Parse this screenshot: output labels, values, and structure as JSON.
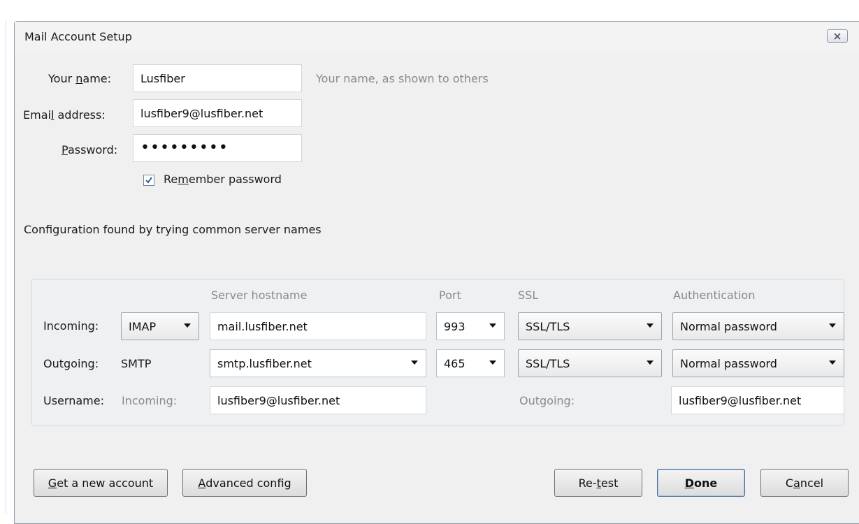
{
  "window": {
    "title": "Mail Account Setup"
  },
  "form": {
    "name_label_pre": "Your ",
    "name_label_u": "n",
    "name_label_post": "ame:",
    "name_value": "Lusfiber",
    "name_hint": "Your name, as shown to others",
    "email_label_pre": "Emai",
    "email_label_u": "l",
    "email_label_post": " address:",
    "email_value": "lusfiber9@lusfiber.net",
    "password_label_u": "P",
    "password_label_post": "assword:",
    "password_value": "•••••••••",
    "remember_checked": true,
    "remember_pre": "Re",
    "remember_u": "m",
    "remember_post": "ember password"
  },
  "status_text": "Configuration found by trying common server names",
  "servers": {
    "headers": {
      "hostname": "Server hostname",
      "port": "Port",
      "ssl": "SSL",
      "auth": "Authentication"
    },
    "incoming": {
      "label": "Incoming:",
      "protocol": "IMAP",
      "hostname": "mail.lusfiber.net",
      "port": "993",
      "ssl": "SSL/TLS",
      "auth": "Normal password"
    },
    "outgoing": {
      "label": "Outgoing:",
      "protocol": "SMTP",
      "hostname": "smtp.lusfiber.net",
      "port": "465",
      "ssl": "SSL/TLS",
      "auth": "Normal password"
    },
    "username": {
      "label": "Username:",
      "incoming_label": "Incoming:",
      "incoming_value": "lusfiber9@lusfiber.net",
      "outgoing_label": "Outgoing:",
      "outgoing_value": "lusfiber9@lusfiber.net"
    }
  },
  "buttons": {
    "new_account_u": "G",
    "new_account_post": "et a new account",
    "advanced_u": "A",
    "advanced_post": "dvanced config",
    "retest_pre": "Re-",
    "retest_u": "t",
    "retest_post": "est",
    "done_u": "D",
    "done_post": "one",
    "cancel_pre": "C",
    "cancel_u": "a",
    "cancel_post": "ncel"
  },
  "colors": {
    "window_bg": "#f0f0f0",
    "hint_text": "#8a8a8a",
    "checkbox_check": "#2a5ea8"
  },
  "icons": {
    "close": "close-icon",
    "dropdown": "dropdown-caret-icon",
    "check": "checkmark-icon"
  }
}
